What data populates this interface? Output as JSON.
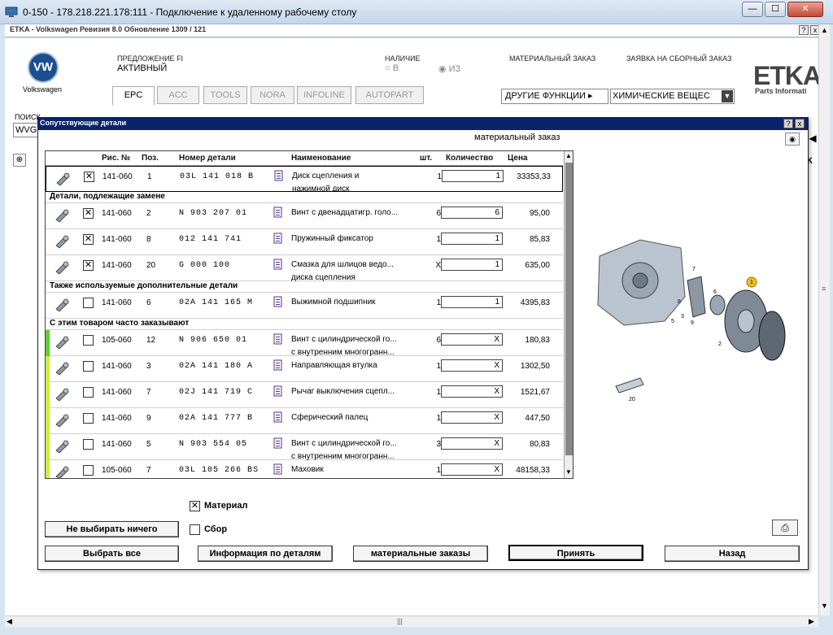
{
  "rdp": {
    "title": "0-150 - 178.218.221.178:111 - Подключение к удаленному рабочему столу",
    "min_label": "—",
    "max_label": "☐",
    "close_label": "✕"
  },
  "etka": {
    "title": "ETKA - Volkswagen Ревизия 8.0 Обновление 1309 / 121",
    "help_label": "?",
    "close_label": "x",
    "brand": "Volkswagen",
    "logo_text": "VW",
    "offer_label": "ПРЕДЛОЖЕНИЕ FI",
    "offer_value": "АКТИВНЫЙ",
    "availability_label": "НАЛИЧИЕ",
    "availability_b": "○ В",
    "availability_iz": "◉ ИЗ",
    "material_order_label": "МАТЕРИАЛЬНЫЙ ЗАКАЗ",
    "assembly_order_label": "ЗАЯВКА НА СБОРНЫЙ ЗАКАЗ",
    "etka_logo": "ETKA",
    "etka_sub": "Parts Informati",
    "tabs": [
      "EPC",
      "ACC",
      "TOOLS",
      "NORA",
      "INFOLINE",
      "AUTOPART"
    ],
    "other_functions": "ДРУГИЕ ФУНКЦИИ ▸",
    "chem_select": "ХИМИЧЕСКИЕ ВЕЩЕС",
    "search_label": "ПОИСК",
    "search_value": "WVG",
    "right_k": "К"
  },
  "dialog": {
    "title": "Сопутствующие детали",
    "subtitle": "материальный заказ",
    "help_label": "?",
    "close_label": "x",
    "columns": {
      "fig": "Рис. №",
      "pos": "Поз.",
      "part": "Номер детали",
      "name": "Наименование",
      "qty": "шт.",
      "amount": "Количество",
      "price": "Цена"
    },
    "sections": [
      "Детали, подлежащие замене",
      "Также используемые дополнительные детали",
      "С этим товаром часто заказывают"
    ],
    "rows": [
      {
        "checked": "✕",
        "fig": "141-060",
        "pos": "1",
        "part": "03L  141  018  B",
        "name1": "Диск сцепления и",
        "name2": "нажимной диск",
        "qty": "1",
        "amount": "1",
        "price": "33353,33"
      },
      {
        "checked": "✕",
        "fig": "141-060",
        "pos": "2",
        "part": "N    903  207  01",
        "name1": "Винт с двенадцатигр. голо...",
        "name2": "",
        "qty": "6",
        "amount": "6",
        "price": "95,00"
      },
      {
        "checked": "✕",
        "fig": "141-060",
        "pos": "8",
        "part": "012  141  741",
        "name1": "Пружинный фиксатор",
        "name2": "",
        "qty": "1",
        "amount": "1",
        "price": "85,83"
      },
      {
        "checked": "✕",
        "fig": "141-060",
        "pos": "20",
        "part": "G    000  100",
        "name1": "Смазка для шлицов ведо...",
        "name2": "диска сцепления",
        "qty": "X",
        "amount": "1",
        "price": "635,00"
      },
      {
        "checked": "",
        "fig": "141-060",
        "pos": "6",
        "part": "02A  141  165  M",
        "name1": "Выжимной подшипник",
        "name2": "",
        "qty": "1",
        "amount": "1",
        "price": "4395,83"
      },
      {
        "checked": "",
        "fig": "105-060",
        "pos": "12",
        "part": "N    906  650  01",
        "name1": "Винт с цилиндрической го...",
        "name2": "с внутренним многогранн...",
        "qty": "6",
        "amount": "X",
        "price": "180,83"
      },
      {
        "checked": "",
        "fig": "141-060",
        "pos": "3",
        "part": "02A  141  180  A",
        "name1": "Направляющая втулка",
        "name2": "",
        "qty": "1",
        "amount": "X",
        "price": "1302,50"
      },
      {
        "checked": "",
        "fig": "141-060",
        "pos": "7",
        "part": "02J  141  719  C",
        "name1": "Рычаг выключения сцепл...",
        "name2": "",
        "qty": "1",
        "amount": "X",
        "price": "1521,67"
      },
      {
        "checked": "",
        "fig": "141-060",
        "pos": "9",
        "part": "02A  141  777  B",
        "name1": "Сферический палец",
        "name2": "",
        "qty": "1",
        "amount": "X",
        "price": "447,50"
      },
      {
        "checked": "",
        "fig": "141-060",
        "pos": "5",
        "part": "N    903  554  05",
        "name1": "Винт с цилиндрической го...",
        "name2": "с внутренним многогранн...",
        "qty": "3",
        "amount": "X",
        "price": "80,83"
      },
      {
        "checked": "",
        "fig": "105-060",
        "pos": "7",
        "part": "03L  105  266  BS",
        "name1": "Маховик",
        "name2": "",
        "qty": "1",
        "amount": "X",
        "price": "48158,33"
      }
    ],
    "material_checkbox": "✕",
    "material_label": "Материал",
    "assembly_label": "Сбор",
    "btn_none": "Не выбирать ничего",
    "btn_all": "Выбрать все",
    "btn_info": "Информация по деталям",
    "btn_matorders": "материальные заказы",
    "btn_accept": "Принять",
    "btn_back": "Назад",
    "drawing_labels": [
      "7",
      "8",
      "6",
      "3",
      "9",
      "5",
      "2",
      "20",
      "1"
    ]
  },
  "colors": {
    "rdp_title_bg": "#c4d6ea",
    "dialog_title_bg": "#0a246a",
    "green_bar_bright": "#5ad22a",
    "green_bar_light": "#c9f23a",
    "accent_callout": "#f0c020"
  }
}
